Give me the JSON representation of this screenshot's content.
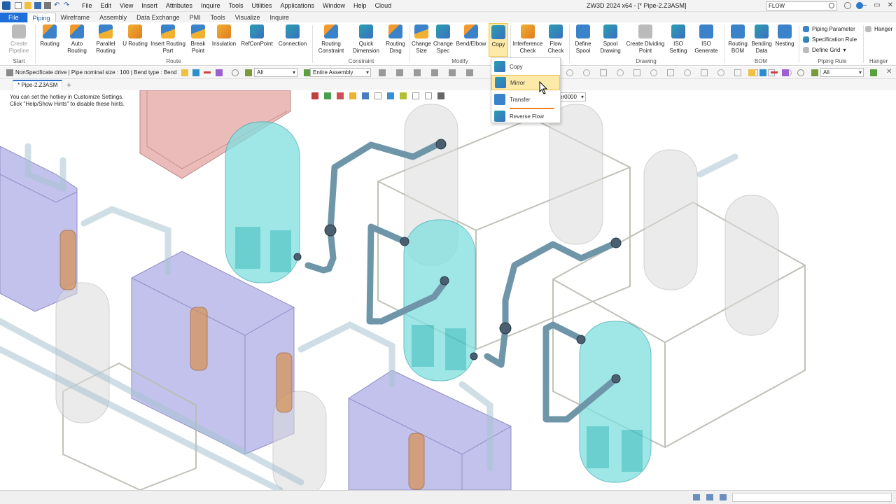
{
  "app": {
    "title": "ZW3D 2024  x64 - [* Pipe-2.Z3ASM]",
    "search_value": "FLOW"
  },
  "menu": [
    "File",
    "Edit",
    "View",
    "Insert",
    "Attributes",
    "Inquire",
    "Tools",
    "Utilities",
    "Applications",
    "Window",
    "Help",
    "Cloud"
  ],
  "tabs": [
    "File",
    "Piping",
    "Wireframe",
    "Assembly",
    "Data Exchange",
    "PMI",
    "Tools",
    "Visualize",
    "Inquire"
  ],
  "active_tab": "Piping",
  "ribbon": {
    "buttons": [
      {
        "label": "Create\nPipeline",
        "icon": "create-pipeline-icon"
      },
      {
        "label": "Routing",
        "icon": "routing-icon"
      },
      {
        "label": "Auto\nRouting",
        "icon": "auto-routing-icon"
      },
      {
        "label": "Parallel\nRouting",
        "icon": "parallel-routing-icon"
      },
      {
        "label": "U Routing",
        "icon": "u-routing-icon"
      },
      {
        "label": "Insert Routing\nPart",
        "icon": "insert-routing-part-icon"
      },
      {
        "label": "Break\nPoint",
        "icon": "break-point-icon"
      },
      {
        "label": "Insulation",
        "icon": "insulation-icon"
      },
      {
        "label": "RefConPoint",
        "icon": "refconpoint-icon"
      },
      {
        "label": "Connection",
        "icon": "connection-icon"
      },
      {
        "label": "Routing\nConstraint",
        "icon": "routing-constraint-icon"
      },
      {
        "label": "Quick\nDimension",
        "icon": "quick-dimension-icon"
      },
      {
        "label": "Routing\nDrag",
        "icon": "routing-drag-icon"
      },
      {
        "label": "Change\nSize",
        "icon": "change-size-icon"
      },
      {
        "label": "Change\nSpec",
        "icon": "change-spec-icon"
      },
      {
        "label": "Bend/Elbow",
        "icon": "bend-elbow-icon"
      },
      {
        "label": "Copy",
        "icon": "copy-icon"
      },
      {
        "label": "Interference\nCheck",
        "icon": "interference-check-icon"
      },
      {
        "label": "Flow\nCheck",
        "icon": "flow-check-icon"
      },
      {
        "label": "Define\nSpool",
        "icon": "define-spool-icon"
      },
      {
        "label": "Spool\nDrawing",
        "icon": "spool-drawing-icon"
      },
      {
        "label": "Create Dividing\nPoint",
        "icon": "create-dividing-point-icon"
      },
      {
        "label": "ISO\nSetting",
        "icon": "iso-setting-icon"
      },
      {
        "label": "ISO\nGenerate",
        "icon": "iso-generate-icon"
      },
      {
        "label": "Routing\nBOM",
        "icon": "routing-bom-icon"
      },
      {
        "label": "Bending\nData",
        "icon": "bending-data-icon"
      },
      {
        "label": "Nesting",
        "icon": "nesting-icon"
      }
    ],
    "groups": [
      "Start",
      "Route",
      "Constraint",
      "Modify",
      "Drawing",
      "BOM",
      "Piping Rule",
      "Hanger"
    ],
    "piping_rule_items": [
      "Piping Parameter",
      "Specification Rule",
      "Define Grid"
    ],
    "hanger_label": "Hanger"
  },
  "toolbar": {
    "info": "NonSpecificate drive | Pipe nominal size : 100 | Bend type : Bend",
    "filter_all": "All",
    "scope": "Entire Assembly",
    "filter_all_right": "All",
    "layer_combo": "er0000"
  },
  "document_tab": "* Pipe-2.Z3ASM",
  "hint": {
    "line1": "You can set the hotkey in Customize Settings.",
    "line2": "Click \"Help/Show Hints\" to disable these hints."
  },
  "copy_menu": {
    "items": [
      "Copy",
      "Mirror",
      "Transfer",
      "Reverse Flow"
    ],
    "highlighted": "Mirror"
  },
  "colors": {
    "accent": "#1e6fd9",
    "highlight": "#fde9a8",
    "tank_teal": "#5ad2d2",
    "box_purple": "#9c9ae0",
    "box_red": "#e8a0a0",
    "pipe": "#6f95a8"
  }
}
